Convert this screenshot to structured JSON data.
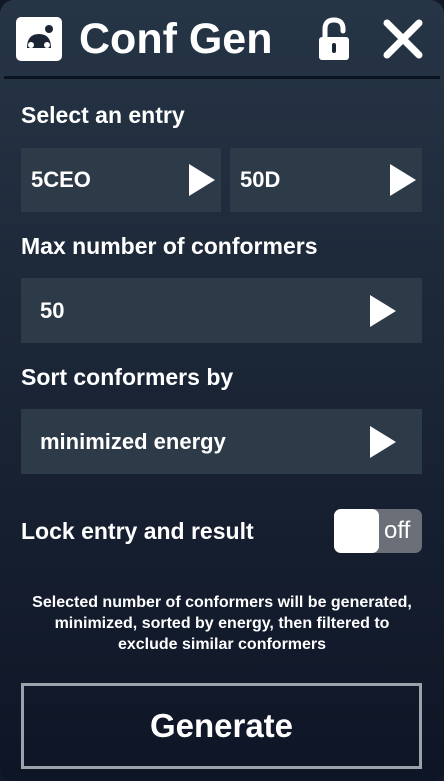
{
  "header": {
    "title": "Conf Gen",
    "logo_icon": "molecule-logo-icon",
    "lock_icon": "unlocked-padlock-icon",
    "close_icon": "close-x-icon"
  },
  "entry": {
    "label": "Select an entry",
    "entry_value": "5CEO",
    "sub_value": "50D"
  },
  "max_conformers": {
    "label": "Max number of conformers",
    "value": "50"
  },
  "sort": {
    "label": "Sort conformers by",
    "value": "minimized energy"
  },
  "lock": {
    "label": "Lock entry and result",
    "state": "off"
  },
  "note": "Selected number of conformers will be generated, minimized, sorted by energy, then filtered to exclude similar conformers",
  "generate_label": "Generate",
  "colors": {
    "panel_top": "#263546",
    "panel_bottom": "#0e1526",
    "dropdown_bg": "#2d3a48",
    "toggle_off": "#6b7078",
    "button_border": "#9aa3ac"
  }
}
